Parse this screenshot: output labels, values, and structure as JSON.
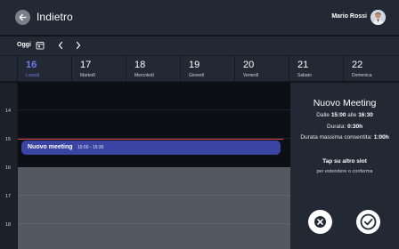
{
  "header": {
    "back_label": "Indietro",
    "user_name": "Mario Rossi"
  },
  "toolbar": {
    "today_label": "Oggi"
  },
  "days": [
    {
      "num": "16",
      "name": "Lunedì"
    },
    {
      "num": "17",
      "name": "Martedì"
    },
    {
      "num": "18",
      "name": "Mercoledì"
    },
    {
      "num": "19",
      "name": "Giovedì"
    },
    {
      "num": "20",
      "name": "Venerdì"
    },
    {
      "num": "21",
      "name": "Sabato"
    },
    {
      "num": "22",
      "name": "Domenica"
    }
  ],
  "hours": [
    "14",
    "15",
    "16",
    "17",
    "18"
  ],
  "event": {
    "title": "Nuovo meeting",
    "time": "15:00 - 15:30"
  },
  "panel": {
    "title": "Nuovo Meeting",
    "range_prefix": "Dalle",
    "start": "15:00",
    "range_mid": "alle",
    "end": "16:30",
    "duration_label": "Durata:",
    "duration": "0:30h",
    "max_label": "Durata massima consentita:",
    "max_duration": "1:00h",
    "hint": "Tap su altro slot",
    "sub": "per estendere o conferma"
  },
  "colors": {
    "accent": "#6d79e6",
    "event": "#3a44a3",
    "now_line": "#e0404a",
    "background": "#0e1117",
    "panel": "#222834"
  }
}
